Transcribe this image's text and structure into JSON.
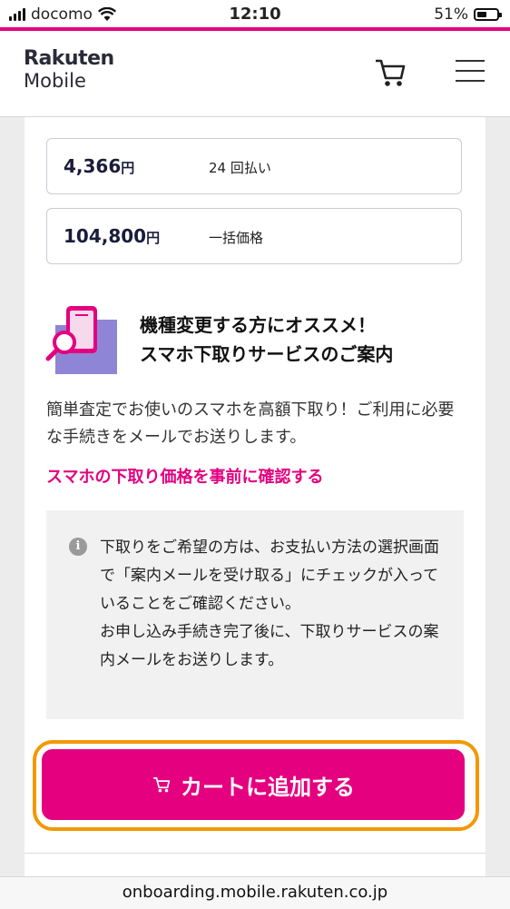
{
  "status_bar": {
    "carrier": "docomo",
    "time": "12:10",
    "battery": "51%",
    "battery_level": 0.51
  },
  "header": {
    "logo_line1": "Rakuten",
    "logo_line2": "Mobile"
  },
  "prices": [
    {
      "amount": "4,366",
      "unit": "円",
      "desc": "24 回払い"
    },
    {
      "amount": "104,800",
      "unit": "円",
      "desc": "一括価格"
    }
  ],
  "promo": {
    "title_line1": "機種変更する方にオススメ！",
    "title_line2": "スマホ下取りサービスのご案内",
    "description": "簡単査定でお使いのスマホを高額下取り！ご利用に必要な手続きをメールでお送りします。",
    "link": "スマホの下取り価格を事前に確認する"
  },
  "note": {
    "icon": "i",
    "text1": "下取りをご希望の方は、お支払い方法の選択画面で「案内メールを受け取る」にチェックが入っていることをご確認ください。",
    "text2": "お申し込み手続き完了後に、下取りサービスの案内メールをお送りします。"
  },
  "cta": {
    "label": "カートに追加する"
  },
  "url_bar": {
    "url": "onboarding.mobile.rakuten.co.jp"
  },
  "colors": {
    "brand": "#e4007f",
    "highlight_ring": "#f39800",
    "price_text": "#1a1c3a"
  }
}
